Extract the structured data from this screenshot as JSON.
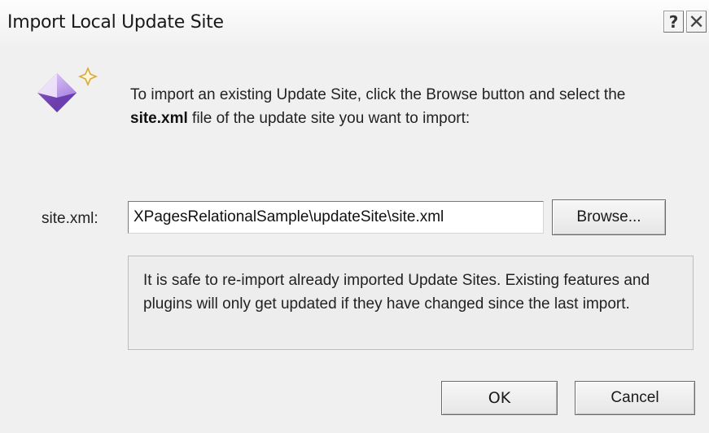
{
  "window": {
    "title": "Import Local Update Site",
    "help_label": "?",
    "close_label": "✕"
  },
  "icon": {
    "name": "update-site-gem-icon",
    "colors": {
      "gem": "#9b6bd6",
      "sparkle": "#e0b64a"
    }
  },
  "intro": {
    "text_before": "To import an existing Update Site, click the Browse button and select the ",
    "bold": "site.xml",
    "text_after": " file of the update site you want to import:"
  },
  "field": {
    "label": "site.xml:",
    "value": "XPagesRelationalSample\\updateSite\\site.xml"
  },
  "buttons": {
    "browse": "Browse...",
    "ok": "OK",
    "cancel": "Cancel"
  },
  "note": {
    "text": "It is safe to re-import already imported Update Sites. Existing features and plugins will only get updated if they have changed since the last import."
  }
}
